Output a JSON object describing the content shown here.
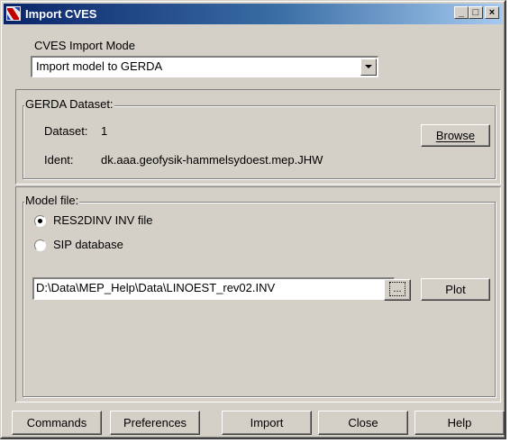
{
  "window": {
    "title": "Import CVES",
    "controls": {
      "minimize": "_",
      "maximize": "□",
      "close": "×"
    }
  },
  "import_mode": {
    "label": "CVES Import Mode",
    "selected": "Import model to GERDA"
  },
  "gerda": {
    "group_title": "GERDA Dataset:",
    "dataset_label": "Dataset:",
    "dataset_value": "1",
    "ident_label": "Ident:",
    "ident_value": "dk.aaa.geofysik-hammelsydoest.mep.JHW",
    "browse_button": "Browse"
  },
  "model_file": {
    "group_title": "Model file:",
    "options": [
      {
        "label": "RES2DINV INV file",
        "selected": true
      },
      {
        "label": "SIP database",
        "selected": false
      }
    ],
    "path": "D:\\Data\\MEP_Help\\Data\\LINOEST_rev02.INV",
    "browse_dots": "...",
    "plot_button": "Plot"
  },
  "footer": {
    "commands": "Commands",
    "preferences": "Preferences",
    "import": "Import",
    "close": "Close",
    "help": "Help"
  }
}
